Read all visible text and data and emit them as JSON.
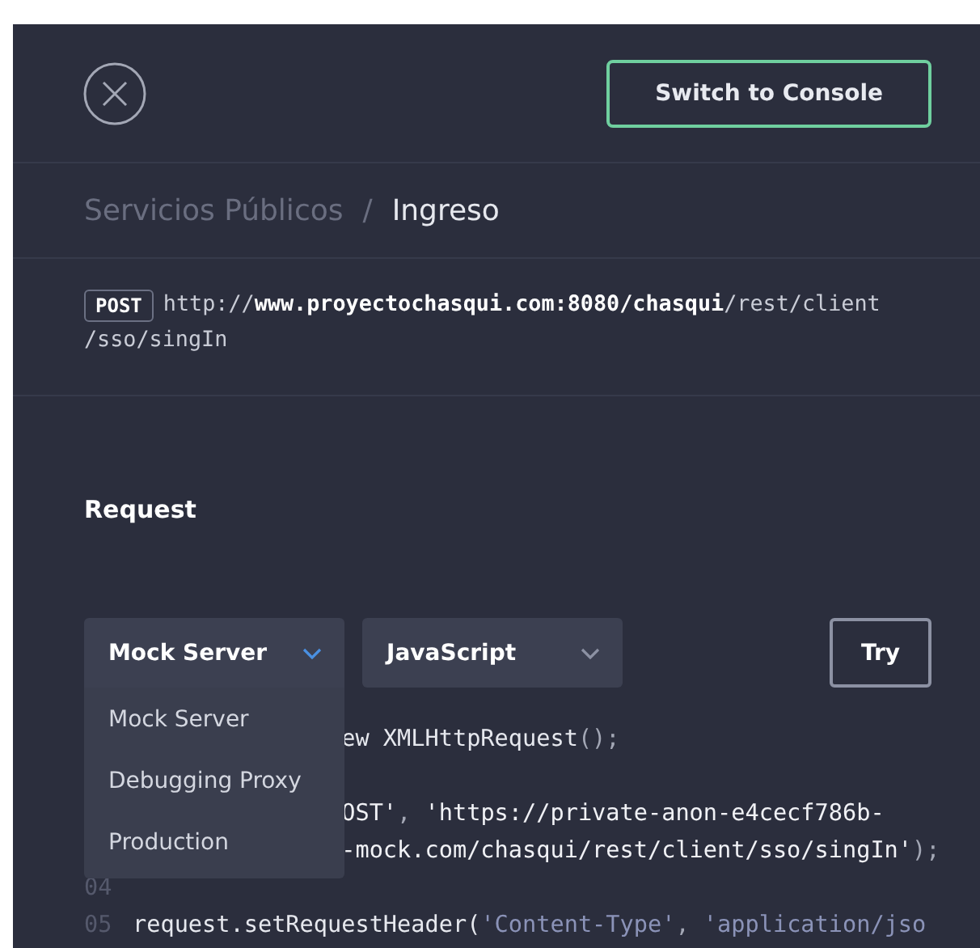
{
  "header": {
    "console_button": "Switch to Console"
  },
  "breadcrumb": {
    "separator": "/",
    "items": [
      {
        "label": "Servicios Públicos",
        "current": false
      },
      {
        "label": "Ingreso",
        "current": true
      }
    ]
  },
  "endpoint": {
    "method": "POST",
    "url_lines": [
      "http://**www.proyectochasqui.com:8080/chasqui**/rest/client",
      "/sso/singIn"
    ]
  },
  "section_title": "Request",
  "selects": [
    {
      "value": "Mock Server",
      "expanded": true,
      "options": [
        "Mock Server",
        "Debugging Proxy",
        "Production"
      ]
    },
    {
      "value": "JavaScript",
      "expanded": false
    }
  ],
  "try_button": "Try",
  "code_lines": [
    {
      "kind": "code",
      "covered": true,
      "tokens": [
        {
          "kind": "plain",
          "text": "ew XMLHttpRequest"
        },
        {
          "kind": "punct",
          "text": "();"
        }
      ]
    },
    {
      "kind": "blank"
    },
    {
      "kind": "code",
      "covered": true,
      "tokens": [
        {
          "kind": "string",
          "text": "OST'"
        },
        {
          "kind": "punct",
          "text": ", "
        },
        {
          "kind": "string",
          "text": "'https://private-anon-e4cecf786b-"
        }
      ]
    },
    {
      "kind": "code",
      "covered": true,
      "tokens": [
        {
          "kind": "string",
          "text": "-mock.com/chasqui/rest/client/sso/singIn'"
        },
        {
          "kind": "punct",
          "text": ");"
        }
      ]
    },
    {
      "kind": "blank",
      "number": "04"
    },
    {
      "kind": "code",
      "covered": false,
      "number": "05",
      "tokens": [
        {
          "kind": "plain",
          "text": "request.setRequestHeader("
        },
        {
          "kind": "value",
          "text": "'Content-Type'"
        },
        {
          "kind": "punct",
          "text": ", "
        },
        {
          "kind": "value",
          "text": "'application/jso"
        }
      ]
    }
  ]
}
